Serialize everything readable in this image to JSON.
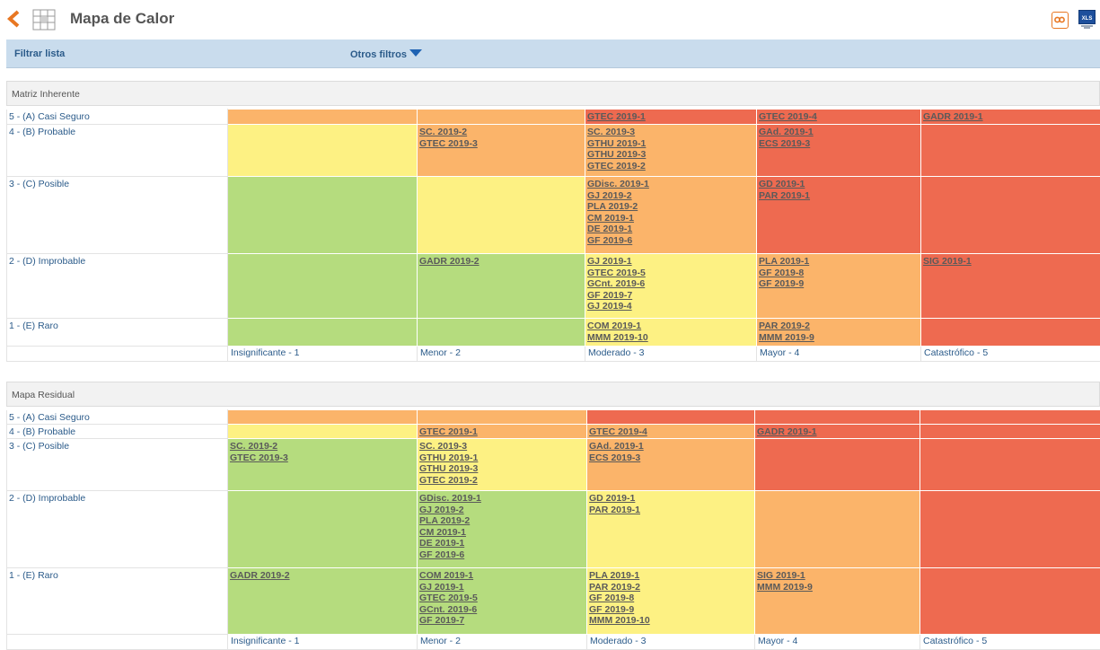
{
  "header": {
    "title": "Mapa de Calor"
  },
  "filters": {
    "filter_list": "Filtrar lista",
    "other_filters": "Otros filtros"
  },
  "colors": {
    "green": "#b5dc7e",
    "yellow": "#fdf183",
    "orange": "#fbb46a",
    "red": "#ee6a50"
  },
  "inherent": {
    "title": "Matriz Inherente",
    "rows": [
      {
        "label": "5 - (A) Casi Seguro",
        "cells": [
          {
            "color": "o",
            "items": []
          },
          {
            "color": "o",
            "items": []
          },
          {
            "color": "r",
            "items": [
              "GTEC 2019-1"
            ]
          },
          {
            "color": "r",
            "items": [
              "GTEC 2019-4"
            ]
          },
          {
            "color": "r",
            "items": [
              "GADR 2019-1"
            ]
          }
        ]
      },
      {
        "label": "4 - (B) Probable",
        "cells": [
          {
            "color": "y",
            "items": []
          },
          {
            "color": "o",
            "items": [
              "SC. 2019-2",
              "GTEC 2019-3"
            ]
          },
          {
            "color": "o",
            "items": [
              "SC. 2019-3",
              "GTHU 2019-1",
              "GTHU 2019-3",
              "GTEC 2019-2"
            ]
          },
          {
            "color": "r",
            "items": [
              "GAd. 2019-1",
              "ECS 2019-3"
            ]
          },
          {
            "color": "r",
            "items": []
          }
        ]
      },
      {
        "label": "3 - (C) Posible",
        "cells": [
          {
            "color": "g",
            "items": []
          },
          {
            "color": "y",
            "items": []
          },
          {
            "color": "o",
            "items": [
              "GDisc. 2019-1",
              "GJ 2019-2",
              "PLA 2019-2",
              "CM 2019-1",
              "DE 2019-1",
              "GF 2019-6"
            ]
          },
          {
            "color": "r",
            "items": [
              "GD 2019-1",
              "PAR 2019-1"
            ]
          },
          {
            "color": "r",
            "items": []
          }
        ]
      },
      {
        "label": "2 - (D) Improbable",
        "cells": [
          {
            "color": "g",
            "items": []
          },
          {
            "color": "g",
            "items": [
              "GADR 2019-2"
            ]
          },
          {
            "color": "y",
            "items": [
              "GJ 2019-1",
              "GTEC 2019-5",
              "GCnt. 2019-6",
              "GF 2019-7",
              "GJ 2019-4"
            ]
          },
          {
            "color": "o",
            "items": [
              "PLA 2019-1",
              "GF 2019-8",
              "GF 2019-9"
            ]
          },
          {
            "color": "r",
            "items": [
              "SIG 2019-1"
            ]
          }
        ]
      },
      {
        "label": "1 - (E) Raro",
        "cells": [
          {
            "color": "g",
            "items": []
          },
          {
            "color": "g",
            "items": []
          },
          {
            "color": "y",
            "items": [
              "COM 2019-1",
              "MMM 2019-10"
            ]
          },
          {
            "color": "o",
            "items": [
              "PAR 2019-2",
              "MMM 2019-9"
            ]
          },
          {
            "color": "r",
            "items": []
          }
        ]
      }
    ],
    "columns": [
      "Insignificante - 1",
      "Menor - 2",
      "Moderado - 3",
      "Mayor - 4",
      "Catastrófico - 5"
    ]
  },
  "residual": {
    "title": "Mapa Residual",
    "rows": [
      {
        "label": "5 - (A) Casi Seguro",
        "cells": [
          {
            "color": "o",
            "items": []
          },
          {
            "color": "o",
            "items": []
          },
          {
            "color": "r",
            "items": []
          },
          {
            "color": "r",
            "items": []
          },
          {
            "color": "r",
            "items": []
          }
        ]
      },
      {
        "label": "4 - (B) Probable",
        "cells": [
          {
            "color": "y",
            "items": []
          },
          {
            "color": "o",
            "items": [
              "GTEC 2019-1"
            ]
          },
          {
            "color": "o",
            "items": [
              "GTEC 2019-4"
            ]
          },
          {
            "color": "r",
            "items": [
              "GADR 2019-1"
            ]
          },
          {
            "color": "r",
            "items": []
          }
        ]
      },
      {
        "label": "3 - (C) Posible",
        "cells": [
          {
            "color": "g",
            "items": [
              "SC. 2019-2",
              "GTEC 2019-3"
            ]
          },
          {
            "color": "y",
            "items": [
              "SC. 2019-3",
              "GTHU 2019-1",
              "GTHU 2019-3",
              "GTEC 2019-2"
            ]
          },
          {
            "color": "o",
            "items": [
              "GAd. 2019-1",
              "ECS 2019-3"
            ]
          },
          {
            "color": "r",
            "items": []
          },
          {
            "color": "r",
            "items": []
          }
        ]
      },
      {
        "label": "2 - (D) Improbable",
        "cells": [
          {
            "color": "g",
            "items": []
          },
          {
            "color": "g",
            "items": [
              "GDisc. 2019-1",
              "GJ 2019-2",
              "PLA 2019-2",
              "CM 2019-1",
              "DE 2019-1",
              "GF 2019-6"
            ]
          },
          {
            "color": "y",
            "items": [
              "GD 2019-1",
              "PAR 2019-1"
            ]
          },
          {
            "color": "o",
            "items": []
          },
          {
            "color": "r",
            "items": []
          }
        ]
      },
      {
        "label": "1 - (E) Raro",
        "cells": [
          {
            "color": "g",
            "items": [
              "GADR 2019-2"
            ]
          },
          {
            "color": "g",
            "items": [
              "COM 2019-1",
              "GJ 2019-1",
              "GTEC 2019-5",
              "GCnt. 2019-6",
              "GF 2019-7"
            ]
          },
          {
            "color": "y",
            "items": [
              "PLA 2019-1",
              "PAR 2019-2",
              "GF 2019-8",
              "GF 2019-9",
              "MMM 2019-10"
            ]
          },
          {
            "color": "o",
            "items": [
              "SIG 2019-1",
              "MMM 2019-9"
            ]
          },
          {
            "color": "r",
            "items": []
          }
        ]
      }
    ],
    "columns": [
      "Insignificante - 1",
      "Menor - 2",
      "Moderado - 3",
      "Mayor - 4",
      "Catastrófico - 5"
    ]
  }
}
